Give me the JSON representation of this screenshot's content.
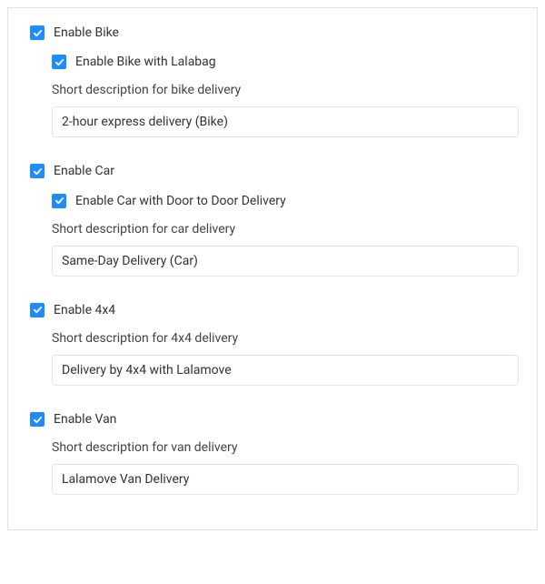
{
  "bike": {
    "enable_label": "Enable Bike",
    "sub_label": "Enable Bike with Lalabag",
    "desc_label": "Short description for bike delivery",
    "desc_value": "2-hour express delivery (Bike)"
  },
  "car": {
    "enable_label": "Enable Car",
    "sub_label": "Enable Car with Door to Door Delivery",
    "desc_label": "Short description for car delivery",
    "desc_value": "Same-Day Delivery (Car)"
  },
  "fourx4": {
    "enable_label": "Enable 4x4",
    "desc_label": "Short description for 4x4 delivery",
    "desc_value": "Delivery by 4x4 with Lalamove"
  },
  "van": {
    "enable_label": "Enable Van",
    "desc_label": "Short description for van delivery",
    "desc_value": "Lalamove Van Delivery"
  }
}
